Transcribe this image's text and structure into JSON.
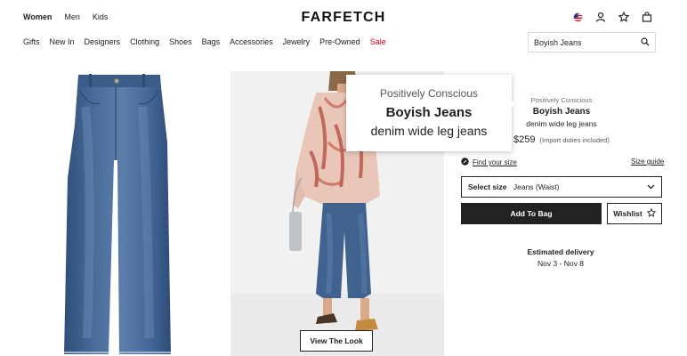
{
  "header": {
    "gender_tabs": [
      "Women",
      "Men",
      "Kids"
    ],
    "logo": "FARFETCH",
    "nav": [
      "Gifts",
      "New In",
      "Designers",
      "Clothing",
      "Shoes",
      "Bags",
      "Accessories",
      "Jewelry",
      "Pre-Owned",
      "Sale"
    ],
    "search_value": "Boyish Jeans",
    "icons": [
      "us-flag-icon",
      "account-icon",
      "wishlist-star-icon",
      "shopping-bag-icon"
    ]
  },
  "gallery": {
    "view_look_label": "View The Look"
  },
  "tooltip": {
    "brand_line": "Positively Conscious",
    "title": "Boyish Jeans",
    "description": "denim wide leg jeans"
  },
  "product": {
    "conscious_label": "Positively Conscious",
    "brand": "Boyish Jeans",
    "description": "denim wide leg jeans",
    "price": "$259",
    "duties_note": "(Import duties included)",
    "find_size": "Find your size",
    "size_guide": "Size guide",
    "select_size_label": "Select size",
    "size_type": "Jeans (Waist)",
    "add_to_bag": "Add To Bag",
    "wishlist": "Wishlist",
    "delivery_label": "Estimated delivery",
    "delivery_dates": "Nov 3 - Nov 8"
  },
  "colors": {
    "text": "#222222",
    "sale": "#d0021b",
    "denim": "#3d5f8c",
    "button_dark": "#222222"
  }
}
